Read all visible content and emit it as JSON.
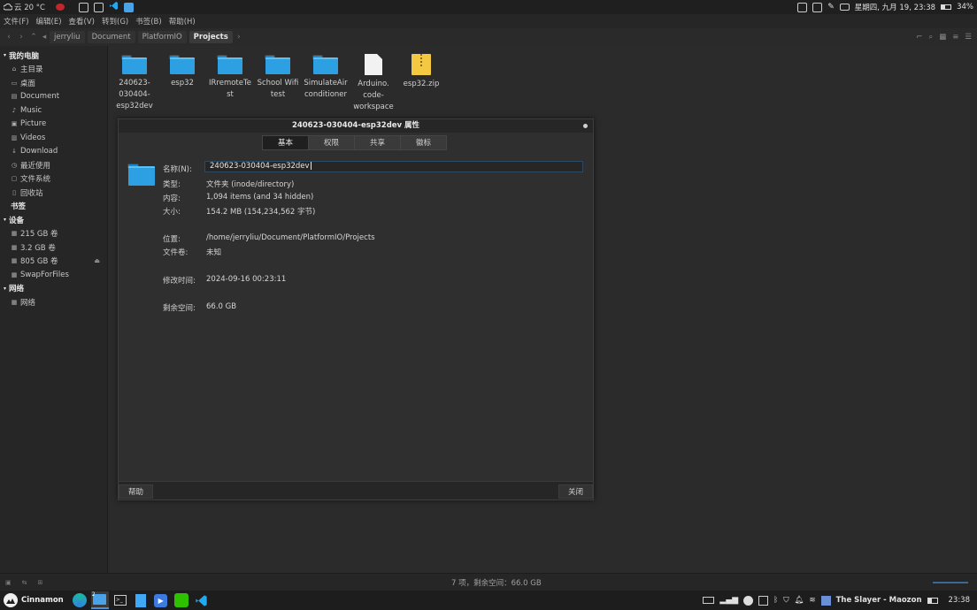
{
  "topbar": {
    "weather": "云 20 °C",
    "datetime": "星期四, 九月 19, 23:38",
    "battery": "34%"
  },
  "menu": [
    "文件(F)",
    "编辑(E)",
    "查看(V)",
    "转到(G)",
    "书签(B)",
    "帮助(H)"
  ],
  "breadcrumbs": [
    "jerryliu",
    "Document",
    "PlatformIO",
    "Projects"
  ],
  "sidebar": {
    "sections": [
      {
        "title": "我的电脑",
        "items": [
          {
            "label": "主目录",
            "icon": "home-icon"
          },
          {
            "label": "桌面",
            "icon": "desktop-icon"
          },
          {
            "label": "Document",
            "icon": "document-icon"
          },
          {
            "label": "Music",
            "icon": "music-icon"
          },
          {
            "label": "Picture",
            "icon": "picture-icon"
          },
          {
            "label": "Videos",
            "icon": "video-icon"
          },
          {
            "label": "Download",
            "icon": "download-icon"
          },
          {
            "label": "最近使用",
            "icon": "recent-icon"
          },
          {
            "label": "文件系统",
            "icon": "filesystem-icon"
          },
          {
            "label": "回收站",
            "icon": "trash-icon"
          }
        ]
      },
      {
        "title": "书签",
        "items": []
      },
      {
        "title": "设备",
        "items": [
          {
            "label": "215 GB 卷",
            "icon": "drive-icon"
          },
          {
            "label": "3.2 GB 卷",
            "icon": "drive-icon"
          },
          {
            "label": "805 GB 卷",
            "icon": "drive-icon",
            "eject": true
          },
          {
            "label": "SwapForFiles",
            "icon": "drive-icon"
          }
        ]
      },
      {
        "title": "网络",
        "items": [
          {
            "label": "网络",
            "icon": "network-icon"
          }
        ]
      }
    ]
  },
  "files": [
    {
      "name": "240623-\n030404-\nesp32dev",
      "type": "folder"
    },
    {
      "name": "esp32",
      "type": "folder"
    },
    {
      "name": "IRremoteTe\nst",
      "type": "folder"
    },
    {
      "name": "School Wifi\ntest",
      "type": "folder"
    },
    {
      "name": "SimulateAir\nconditioner",
      "type": "folder"
    },
    {
      "name": "Arduino.\ncode-\nworkspace",
      "type": "document"
    },
    {
      "name": "esp32.zip",
      "type": "zip"
    }
  ],
  "dialog": {
    "title": "240623-030404-esp32dev 属性",
    "tabs": [
      "基本",
      "权限",
      "共享",
      "徽标"
    ],
    "active_tab": 0,
    "name_label": "名称(N):",
    "name_value": "240623-030404-esp32dev",
    "props": [
      {
        "label": "类型:",
        "value": "文件夹 (inode/directory)"
      },
      {
        "label": "内容:",
        "value": "1,094 items (and 34 hidden)"
      },
      {
        "label": "大小:",
        "value": "154.2 MB (154,234,562 字节)"
      },
      {
        "label": "位置:",
        "value": "/home/jerryliu/Document/PlatformIO/Projects"
      },
      {
        "label": "文件卷:",
        "value": "未知"
      },
      {
        "label": "修改时间:",
        "value": "2024-09-16 00:23:11"
      },
      {
        "label": "剩余空间:",
        "value": "66.0 GB"
      }
    ],
    "help_button": "帮助",
    "close_button": "关闭"
  },
  "statusbar": {
    "text": "7 项，剩余空间：66.0 GB"
  },
  "taskbar": {
    "menu_label": "Cinnamon",
    "badge": "2",
    "now_playing": "The Slayer - Maozon",
    "clock": "23:38"
  },
  "colors": {
    "folder": "#2d9fe3",
    "accent": "#4a90d9"
  }
}
